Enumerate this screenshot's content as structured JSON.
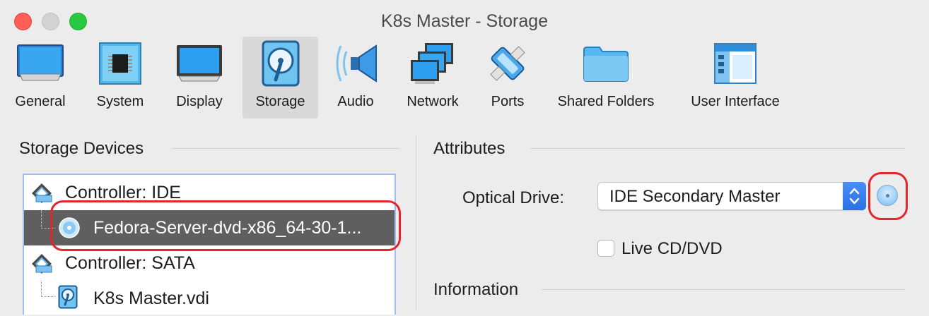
{
  "window": {
    "title": "K8s Master - Storage"
  },
  "toolbar": {
    "items": [
      {
        "label": "General",
        "icon": "monitor-icon"
      },
      {
        "label": "System",
        "icon": "chip-icon"
      },
      {
        "label": "Display",
        "icon": "display-icon"
      },
      {
        "label": "Storage",
        "icon": "storage-disk-icon",
        "selected": true
      },
      {
        "label": "Audio",
        "icon": "speaker-icon"
      },
      {
        "label": "Network",
        "icon": "network-icon"
      },
      {
        "label": "Ports",
        "icon": "ports-icon"
      },
      {
        "label": "Shared Folders",
        "icon": "folder-icon"
      },
      {
        "label": "User Interface",
        "icon": "window-layout-icon"
      }
    ]
  },
  "storage_devices": {
    "title": "Storage Devices",
    "tree": [
      {
        "label": "Controller: IDE",
        "type": "controller",
        "icon": "ide-controller-icon"
      },
      {
        "label": "Fedora-Server-dvd-x86_64-30-1...",
        "type": "optical",
        "icon": "optical-disc-icon",
        "selected": true
      },
      {
        "label": "Controller: SATA",
        "type": "controller",
        "icon": "sata-controller-icon"
      },
      {
        "label": "K8s Master.vdi",
        "type": "disk",
        "icon": "hard-disk-icon"
      }
    ]
  },
  "attributes": {
    "title": "Attributes",
    "optical_drive_label": "Optical Drive:",
    "optical_drive_value": "IDE Secondary Master",
    "live_cd_label": "Live CD/DVD",
    "live_cd_checked": false
  },
  "information": {
    "title": "Information"
  },
  "colors": {
    "accent": "#2a70e6",
    "selection": "#5f5f5f",
    "annotation": "#e3262a",
    "close": "#fe5f57",
    "maximize": "#28c840"
  }
}
